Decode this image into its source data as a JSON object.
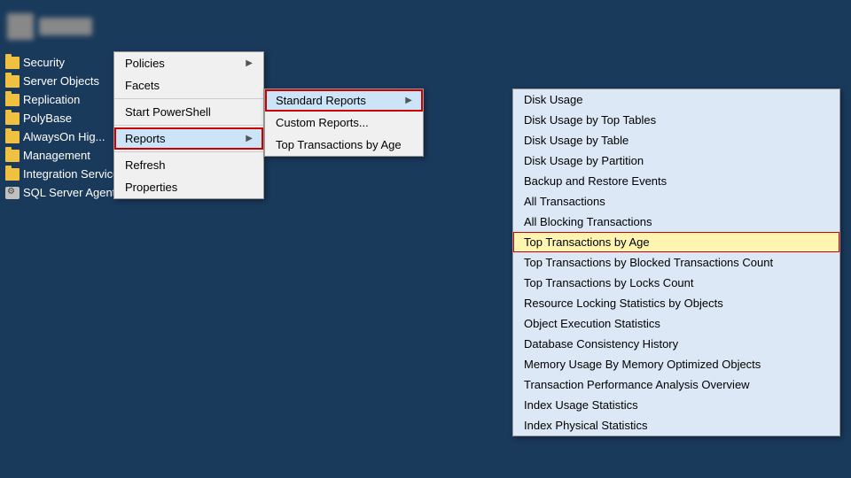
{
  "sidebar": {
    "items": [
      {
        "label": "Security",
        "icon": "folder"
      },
      {
        "label": "Server Objects",
        "icon": "folder"
      },
      {
        "label": "Replication",
        "icon": "folder"
      },
      {
        "label": "PolyBase",
        "icon": "folder"
      },
      {
        "label": "AlwaysOn Hig...",
        "icon": "folder"
      },
      {
        "label": "Management",
        "icon": "folder"
      },
      {
        "label": "Integration Services Catalogs",
        "icon": "folder"
      },
      {
        "label": "SQL Server Agent",
        "icon": "agent"
      }
    ]
  },
  "context_menu_1": {
    "items": [
      {
        "label": "Policies",
        "has_submenu": true
      },
      {
        "label": "Facets",
        "has_submenu": false
      },
      {
        "label": "Start PowerShell",
        "has_submenu": false
      },
      {
        "label": "Reports",
        "has_submenu": true,
        "active": true
      },
      {
        "label": "Refresh",
        "has_submenu": false
      },
      {
        "label": "Properties",
        "has_submenu": false
      }
    ]
  },
  "context_menu_2": {
    "items": [
      {
        "label": "Standard Reports",
        "has_submenu": true,
        "active": true
      },
      {
        "label": "Custom Reports...",
        "has_submenu": false
      },
      {
        "label": "Top Transactions by Age",
        "has_submenu": false
      }
    ]
  },
  "context_menu_4": {
    "items": [
      {
        "label": "Disk Usage",
        "selected": false
      },
      {
        "label": "Disk Usage by Top Tables",
        "selected": false
      },
      {
        "label": "Disk Usage by Table",
        "selected": false
      },
      {
        "label": "Disk Usage by Partition",
        "selected": false
      },
      {
        "label": "Backup and Restore Events",
        "selected": false
      },
      {
        "label": "All Transactions",
        "selected": false
      },
      {
        "label": "All Blocking Transactions",
        "selected": false
      },
      {
        "label": "Top Transactions by Age",
        "selected": true
      },
      {
        "label": "Top Transactions by Blocked Transactions Count",
        "selected": false
      },
      {
        "label": "Top Transactions by Locks Count",
        "selected": false
      },
      {
        "label": "Resource Locking Statistics by Objects",
        "selected": false
      },
      {
        "label": "Object Execution Statistics",
        "selected": false
      },
      {
        "label": "Database Consistency History",
        "selected": false
      },
      {
        "label": "Memory Usage By Memory Optimized Objects",
        "selected": false
      },
      {
        "label": "Transaction Performance Analysis Overview",
        "selected": false
      },
      {
        "label": "Index Usage Statistics",
        "selected": false
      },
      {
        "label": "Index Physical Statistics",
        "selected": false
      }
    ]
  }
}
